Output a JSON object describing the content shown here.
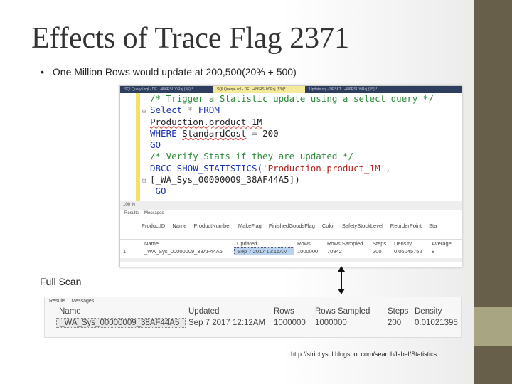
{
  "colors": {
    "sidebar_dark": "#675f4a",
    "sidebar_light": "#a8a582"
  },
  "title": "Effects of Trace Flag 2371",
  "bullet": "One Million Rows would update at 200,500(20% + 500)",
  "editor": {
    "tabs": [
      "SQLQuery5.sql - DE...-486RSUY\\Raj (56))*",
      "SQLQuery4.sql - DE...-486RSUY\\Raj (53))*",
      "Update.sql - DESKT...-486RSUY\\Raj (55))*"
    ],
    "code": {
      "l1": "/* Trigger a Statistic update using a select query */",
      "l2a": "Select",
      "l2b": "*",
      "l2c": "FROM",
      "l3": "Production.product_1M",
      "l4a": "WHERE",
      "l4b": "StandardCost",
      "l4c": "=",
      "l4d": "200",
      "l5": "GO",
      "l6": "/* Verify Stats if they are updated */",
      "l7a": "DBCC SHOW_STATISTICS(",
      "l7b": "'Production.product_1M'",
      "l7c": ",",
      "l8": "[_WA_Sys_00000009_38AF44A5])",
      "l9": "GO"
    },
    "zoom": "100 %",
    "results_tab": "Results",
    "messages_tab": "Messages",
    "grid1_headers": [
      "ProductID",
      "Name",
      "ProductNumber",
      "MakeFlag",
      "FinishedGoodsFlag",
      "Color",
      "SafetyStockLevel",
      "ReorderPoint",
      "Sta"
    ],
    "grid2_headers": [
      "Name",
      "Updated",
      "Rows",
      "Rows Sampled",
      "Steps",
      "Density",
      "Average"
    ],
    "grid2_row": [
      "1",
      "_WA_Sys_00000009_38AF44A5",
      "Sep  7 2017 12:15AM",
      "1000000",
      "70942",
      "200",
      "0.06045752",
      "8"
    ]
  },
  "full_scan_label": "Full Scan",
  "full": {
    "results_tab": "Results",
    "messages_tab": "Messages",
    "headers": [
      "Name",
      "Updated",
      "Rows",
      "Rows Sampled",
      "Steps",
      "Density"
    ],
    "row": [
      "_WA_Sys_00000009_38AF44A5",
      "Sep  7 2017 12:12AM",
      "1000000",
      "1000000",
      "200",
      "0.01021395"
    ]
  },
  "source": "http://strictlysql.blogspot.com/search/label/Statistics"
}
